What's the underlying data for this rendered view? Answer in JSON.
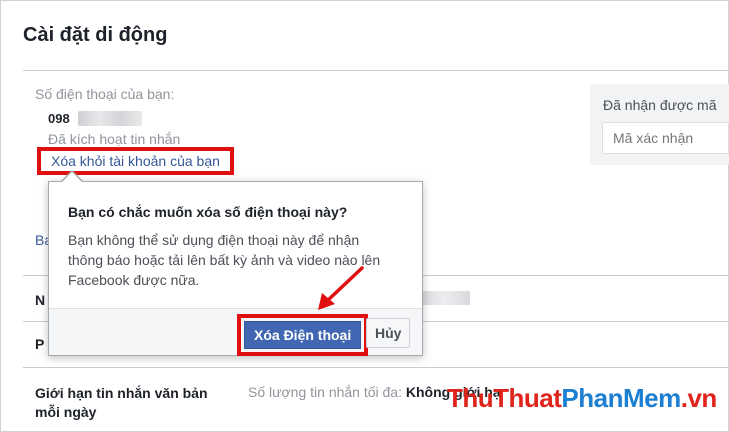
{
  "page": {
    "title": "Cài đặt di động"
  },
  "phone": {
    "label": "Số điện thoại của bạn:",
    "number": "098",
    "sms_status": "Đã kích hoạt tin nhắn",
    "remove_link": "Xóa khỏi tài khoản của bạn",
    "partial_link": "Ba"
  },
  "verify": {
    "label": "Đã nhận được mã",
    "placeholder": "Mã xác nhận"
  },
  "dialog": {
    "title": "Bạn có chắc muốn xóa số điện thoại này?",
    "body": "Bạn không thể sử dụng điện thoại này để nhận thông báo hoặc tải lên bất kỳ ảnh và video nào lên Facebook được nữa.",
    "confirm_label": "Xóa Điện thoại",
    "cancel_label": "Hủy"
  },
  "rows": {
    "ni": "N",
    "pl": "P",
    "limit_title": "Giới hạn tin nhắn văn bản mỗi ngày",
    "limit_value_prefix": "Số lượng tin nhắn tối đa: ",
    "limit_value_bold": "Không giới hạ"
  },
  "watermark": {
    "part1": "ThuThuat",
    "part2": "PhanMem",
    "part3": ".vn"
  },
  "colors": {
    "link": "#365899",
    "primary_button": "#4267b2",
    "highlight": "#e01010"
  }
}
